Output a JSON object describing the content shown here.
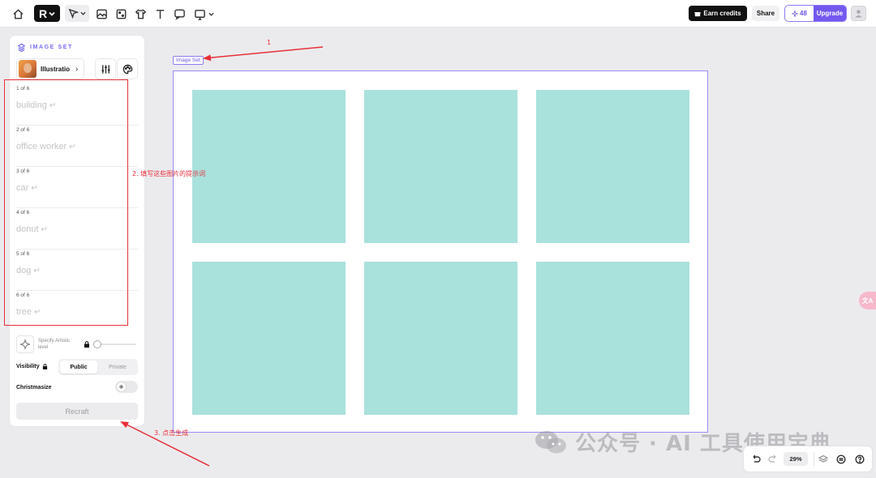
{
  "panel": {
    "title": "IMAGE SET",
    "style_name": "Illustratio",
    "prompts": [
      {
        "count": "1 of 6",
        "text": "building"
      },
      {
        "count": "2 of 6",
        "text": "office worker"
      },
      {
        "count": "3 of 6",
        "text": "car"
      },
      {
        "count": "4 of 6",
        "text": "donut"
      },
      {
        "count": "5 of 6",
        "text": "dog"
      },
      {
        "count": "6 of 6",
        "text": "tree"
      }
    ],
    "artistic_label": "Specify Artistic level",
    "artistic_level": 0,
    "visibility_label": "Visibility",
    "visibility_options": [
      "Public",
      "Private"
    ],
    "visibility_selected": "Public",
    "christmasize_label": "Christmasize",
    "recraft_label": "Recraft"
  },
  "topbar": {
    "earn_label": "Earn credits",
    "share_label": "Share",
    "credits": "48",
    "upgrade_label": "Upgrade"
  },
  "canvas": {
    "frame_label": "Image Set",
    "cell_color": "#a9e1dc",
    "frame_border_color": "#9b8cf4"
  },
  "annotations": {
    "a1": "1",
    "a2": "2. 填写这些图片的提示词",
    "a3": "3. 点击生成",
    "color": "#e8303a"
  },
  "side_tab": "文A",
  "watermark": "公众号 · AI 工具使用宝典",
  "bottom": {
    "zoom": "29%"
  },
  "accent": "#7458f0"
}
